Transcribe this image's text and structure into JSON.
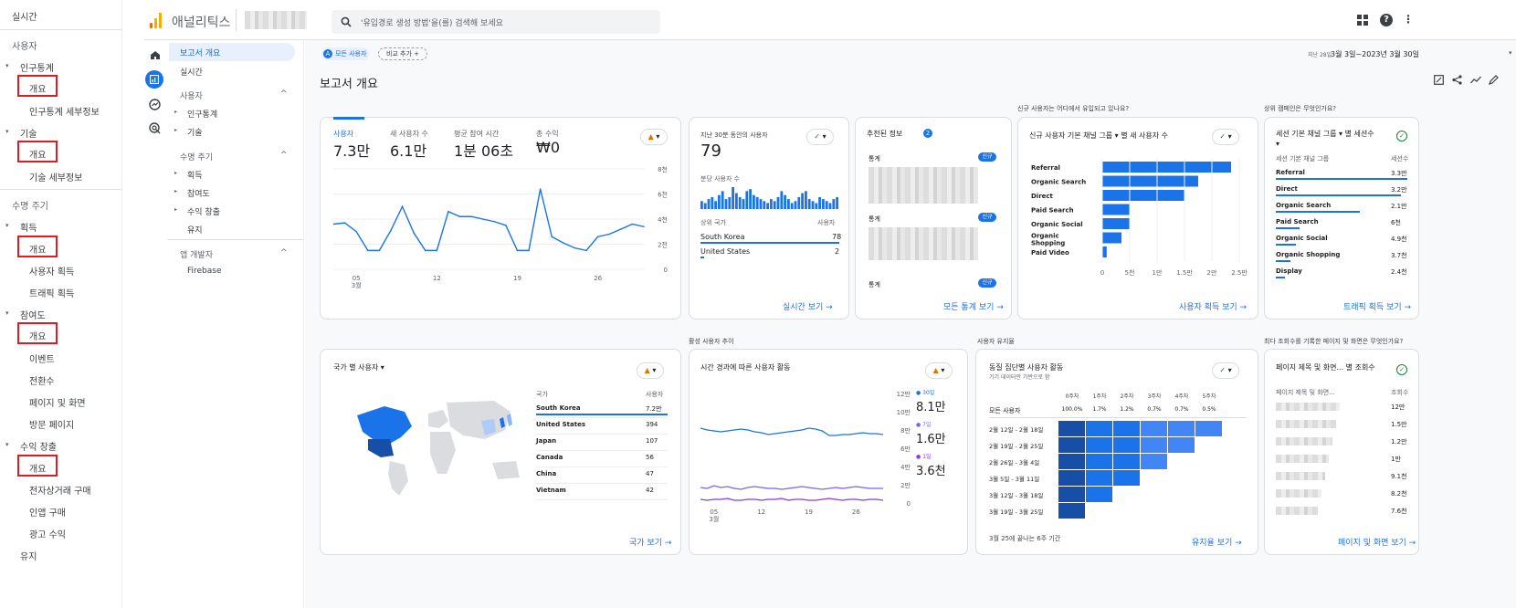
{
  "doc_nav": {
    "realtime": "실시간",
    "users": "사용자",
    "demographics": "인구통계",
    "demographics_overview": "개요",
    "demographics_detail": "인구통계 세부정보",
    "tech": "기술",
    "tech_overview": "개요",
    "tech_detail": "기술 세부정보",
    "lifecycle": "수명 주기",
    "acquisition": "획득",
    "acquisition_overview": "개요",
    "user_acquisition": "사용자 획득",
    "traffic_acquisition": "트래픽 획득",
    "engagement": "참여도",
    "engagement_overview": "개요",
    "events": "이벤트",
    "conversions": "전환수",
    "pages_screens": "페이지 및 화면",
    "landing_page": "방문 페이지",
    "monetization": "수익 창출",
    "monetization_overview": "개요",
    "ecommerce": "전자상거래 구매",
    "in_app": "인앱 구매",
    "ad_revenue": "광고 수익",
    "retention": "유지"
  },
  "topbar": {
    "product": "애널리틱스",
    "search_placeholder": "'유입경로 생성 방법'을(를) 검색해 보세요"
  },
  "subnav": {
    "report_overview": "보고서 개요",
    "realtime": "실시간",
    "users": "사용자",
    "demographics": "인구통계",
    "tech": "기술",
    "lifecycle": "수명 주기",
    "acquisition": "획득",
    "engagement": "참여도",
    "monetization": "수익 창출",
    "retention": "유지",
    "app_dev": "앱 개발자",
    "firebase": "Firebase"
  },
  "header": {
    "all_users": "모든 사용자",
    "add_compare": "비교 추가 +",
    "date_prefix": "지난 28일",
    "date_range": "3월 3일~2023년 3월 30일",
    "title": "보고서 개요"
  },
  "kpi": {
    "users_label": "사용자",
    "users_value": "7.3만",
    "new_users_label": "새 사용자 수",
    "new_users_value": "6.1만",
    "avg_engage_label": "평균 참여 시간",
    "avg_engage_value": "1분 06초",
    "revenue_label": "총 수익",
    "revenue_value": "₩0",
    "y_ticks": [
      "8천",
      "6천",
      "4천",
      "2천",
      "0"
    ],
    "x_ticks": [
      "05\n3월",
      "12",
      "19",
      "26"
    ]
  },
  "chart_data": {
    "type": "line",
    "title": "",
    "x": [
      "3/3",
      "3/4",
      "3/5",
      "3/6",
      "3/7",
      "3/8",
      "3/9",
      "3/10",
      "3/11",
      "3/12",
      "3/13",
      "3/14",
      "3/15",
      "3/16",
      "3/17",
      "3/18",
      "3/19",
      "3/20",
      "3/21",
      "3/22",
      "3/23",
      "3/24",
      "3/25",
      "3/26",
      "3/27",
      "3/28",
      "3/29",
      "3/30"
    ],
    "series": [
      {
        "name": "사용자",
        "values": [
          3600,
          3700,
          3000,
          1500,
          1500,
          3100,
          5000,
          2900,
          1500,
          1500,
          4600,
          4200,
          4200,
          4000,
          3800,
          3500,
          1500,
          1500,
          6400,
          2600,
          2100,
          1700,
          1500,
          2600,
          2800,
          3200,
          3600,
          3400
        ]
      }
    ],
    "ylim": [
      0,
      8000
    ],
    "grid": true
  },
  "realtime": {
    "label": "지난 30분 동안의 사용자",
    "value": "79",
    "per_min": "분당 사용자 수",
    "country_hdr": "상위 국가",
    "users_hdr": "사용자",
    "rows": [
      {
        "country": "South Korea",
        "val": "78"
      },
      {
        "country": "United States",
        "val": "2"
      }
    ],
    "spark": [
      4,
      3,
      5,
      6,
      4,
      7,
      9,
      5,
      6,
      11,
      8,
      6,
      5,
      9,
      10,
      7,
      6,
      5,
      4,
      3,
      5,
      4,
      6,
      9,
      7,
      5,
      3,
      4,
      6,
      8,
      9,
      5,
      4,
      3,
      6,
      5,
      4,
      3,
      5,
      6
    ],
    "link": "실시간 보기 →"
  },
  "insights": {
    "title": "추천된 정보",
    "badge": "2",
    "row_label": "통계",
    "new_badge": "신규",
    "link": "모든 통계 보기 →"
  },
  "acq_section": "신규 사용자는 어디에서 유입되고 있나요?",
  "acq": {
    "title": "신규 사용자 기본 채널 그룹 ▾ 별 새 사용자 수",
    "bars": [
      {
        "label": "Referral",
        "value": 23500
      },
      {
        "label": "Organic Search",
        "value": 17500
      },
      {
        "label": "Direct",
        "value": 15000
      },
      {
        "label": "Paid Search",
        "value": 5000
      },
      {
        "label": "Organic Social",
        "value": 5000
      },
      {
        "label": "Organic Shopping",
        "value": 3500
      },
      {
        "label": "Paid Video",
        "value": 800
      }
    ],
    "x_ticks": [
      "0",
      "5천",
      "1만",
      "1.5만",
      "2만",
      "2.5만"
    ],
    "link": "사용자 획득 보기 →"
  },
  "session_section": "상위 캠페인은 무엇인가요?",
  "session": {
    "title": "세션 기본 채널 그룹 ▾ 별 세션수 ▾",
    "col1": "세션 기본 채널 그룹",
    "col2": "세션수",
    "rows": [
      {
        "label": "Referral",
        "val": "3.3만",
        "ratio": 1.0
      },
      {
        "label": "Direct",
        "val": "3.2만",
        "ratio": 0.95
      },
      {
        "label": "Organic Search",
        "val": "2.1만",
        "ratio": 0.64
      },
      {
        "label": "Paid Search",
        "val": "6천",
        "ratio": 0.18
      },
      {
        "label": "Organic Social",
        "val": "4.9천",
        "ratio": 0.15
      },
      {
        "label": "Organic Shopping",
        "val": "3.7천",
        "ratio": 0.11
      },
      {
        "label": "Display",
        "val": "2.4천",
        "ratio": 0.07
      }
    ],
    "link": "트래픽 획득 보기 →"
  },
  "country": {
    "title": "국가 별 사용자 ▾",
    "col1": "국가",
    "col2": "사용자",
    "rows": [
      {
        "label": "South Korea",
        "val": "7.2만"
      },
      {
        "label": "United States",
        "val": "394"
      },
      {
        "label": "Japan",
        "val": "107"
      },
      {
        "label": "Canada",
        "val": "56"
      },
      {
        "label": "China",
        "val": "47"
      },
      {
        "label": "Vietnam",
        "val": "42"
      }
    ],
    "link": "국가 보기 →"
  },
  "active_section": "활성 사용자 추이",
  "active": {
    "title": "시간 경과에 따른 사용자 활동",
    "y_ticks": [
      "12만",
      "10만",
      "8만",
      "6만",
      "4만",
      "2만",
      "0"
    ],
    "legend": [
      {
        "name": "30일",
        "value": "8.1만",
        "color": "#1a73e8"
      },
      {
        "name": "7일",
        "value": "1.6만",
        "color": "#7b61ff"
      },
      {
        "name": "1일",
        "value": "3.6천",
        "color": "#9334e6"
      }
    ],
    "x_ticks": [
      "05\n3월",
      "12",
      "19",
      "26"
    ]
  },
  "retention_section": "사용자 유지율",
  "cohort": {
    "title": "동질 집단별 사용자 활동",
    "subtitle": "기기 데이터만 기반으로 함",
    "cols": [
      "0주차",
      "1주차",
      "2주차",
      "3주차",
      "4주차",
      "5주차"
    ],
    "all_label": "모든 사용자",
    "all_vals": [
      "100.0%",
      "1.7%",
      "1.2%",
      "0.7%",
      "0.7%",
      "0.5%"
    ],
    "rows": [
      "2월 12일 - 2월 18일",
      "2월 19일 - 2월 25일",
      "2월 26일 - 3월 4일",
      "3월 5일 - 3월 11일",
      "3월 12일 - 3월 18일",
      "3월 19일 - 3월 25일"
    ],
    "footer": "3월 25에 끝나는 6주 기간",
    "link": "유지율 보기 →"
  },
  "pages_section": "최다 조회수를 기록한 페이지 및 화면은 무엇인가요?",
  "pages": {
    "title": "페이지 제목 및 화면... 별 조회수",
    "col1": "페이지 제목 및 화면...",
    "col2": "조회수",
    "vals": [
      "12만",
      "1.5만",
      "1.2만",
      "1만",
      "9.1천",
      "8.2천",
      "7.6천"
    ],
    "link": "페이지 및 화면 보기 →"
  },
  "colors": {
    "accent": "#1a73e8",
    "dark_blue": "#174ea6",
    "red": "#e01b24"
  }
}
